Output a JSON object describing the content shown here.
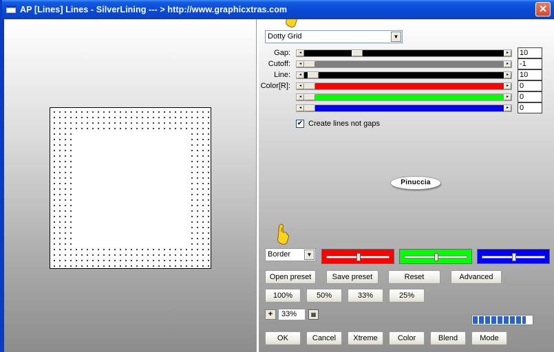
{
  "window": {
    "title": "AP [Lines]  Lines - SilverLining     --- > http://www.graphicxtras.com",
    "close_glyph": "✕"
  },
  "preview": {
    "pattern": "dotty grid"
  },
  "controls": {
    "style_select": {
      "value": "Dotty Grid"
    },
    "sliders": [
      {
        "id": "gap",
        "label": "Gap:",
        "value": "10",
        "level": 0.25,
        "track_color": "#000000"
      },
      {
        "id": "cutoff",
        "label": "Cutoff:",
        "value": "-1",
        "level": 0.0,
        "track_color": "#808080"
      },
      {
        "id": "line",
        "label": "Line:",
        "value": "10",
        "level": 0.02,
        "track_color": "#000000"
      },
      {
        "id": "color_r",
        "label": "Color[R]:",
        "value": "0",
        "level": 0.0,
        "track_color": "#ff0000"
      },
      {
        "id": "color_g",
        "label": "",
        "value": "0",
        "level": 0.0,
        "track_color": "#00ff00"
      },
      {
        "id": "color_b",
        "label": "",
        "value": "0",
        "level": 0.0,
        "track_color": "#0000ff"
      }
    ],
    "create_lines_checkbox": {
      "label": "Create lines not gaps",
      "checked": true
    },
    "logo_text": "Pinuccia",
    "border_select": {
      "value": "Border"
    },
    "color_boxes": [
      {
        "id": "red",
        "color": "#ff0000",
        "level": 0.5
      },
      {
        "id": "green",
        "color": "#00ff00",
        "level": 0.5
      },
      {
        "id": "blue",
        "color": "#0000ff",
        "level": 0.5
      }
    ],
    "preset_buttons": {
      "open_preset": "Open preset",
      "save_preset": "Save preset",
      "reset": "Reset",
      "advanced": "Advanced"
    },
    "zoom_buttons": {
      "z100": "100%",
      "z50": "50%",
      "z33": "33%",
      "z25": "25%"
    },
    "zoom": {
      "plus": "+",
      "value": "33%"
    },
    "progress": {
      "level": 0.9
    },
    "bottom_buttons": {
      "ok": "OK",
      "cancel": "Cancel",
      "xtreme": "Xtreme",
      "color": "Color",
      "blend": "Blend",
      "mode": "Mode"
    }
  }
}
